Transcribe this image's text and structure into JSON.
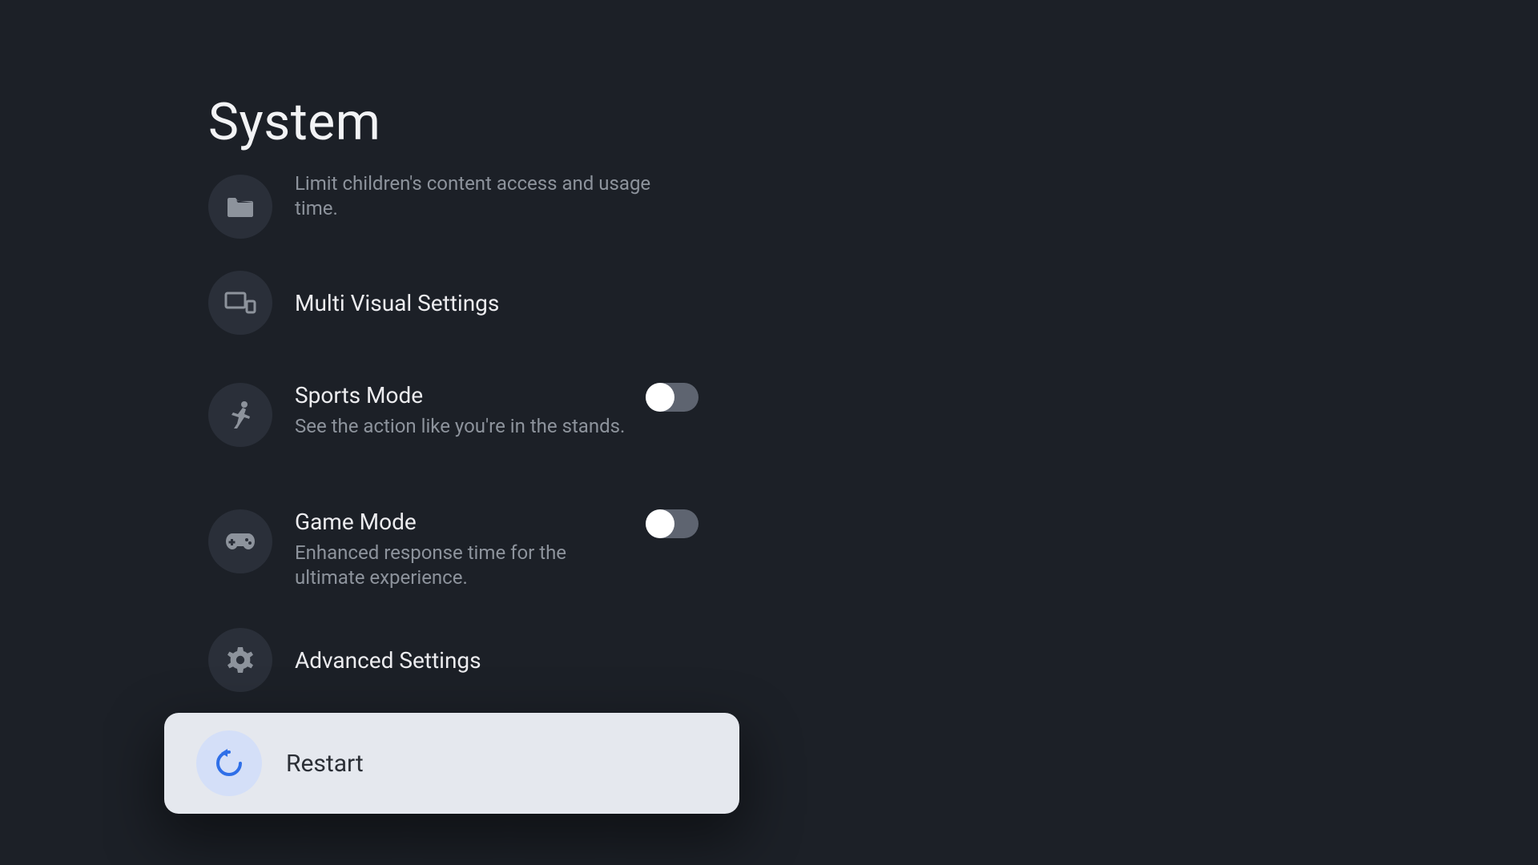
{
  "title": "System",
  "rows": {
    "parental": {
      "desc": "Limit children's content access and usage time."
    },
    "multi": {
      "title": "Multi Visual Settings"
    },
    "sports": {
      "title": "Sports Mode",
      "desc": "See the action like you're in the stands.",
      "toggle": false
    },
    "game": {
      "title": "Game Mode",
      "desc": "Enhanced response time for the ultimate experience.",
      "toggle": false
    },
    "advanced": {
      "title": "Advanced Settings"
    },
    "restart": {
      "title": "Restart"
    }
  },
  "colors": {
    "bg": "#1c2027",
    "card": "#e5e8ee",
    "accent": "#3a7bf0"
  }
}
